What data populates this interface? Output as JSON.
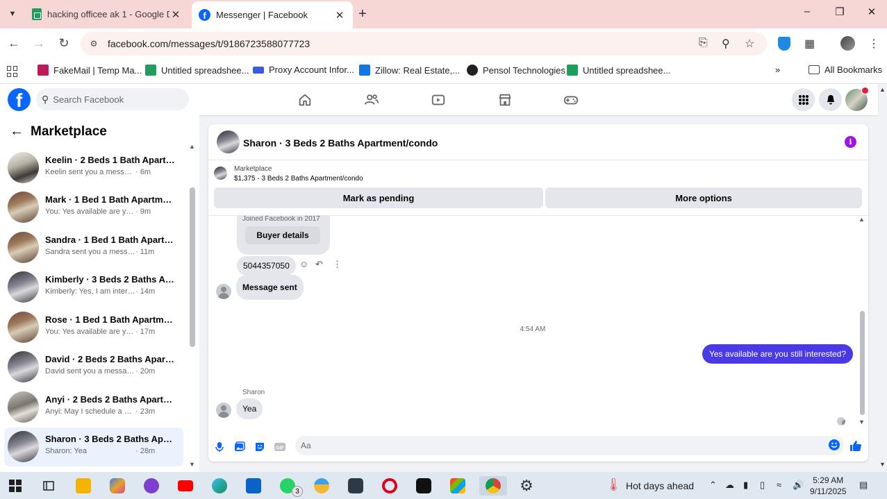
{
  "browser": {
    "tabs": [
      {
        "title": "hacking officee ak 1 - Google D",
        "favicon": "sheets-icon"
      },
      {
        "title": "Messenger | Facebook",
        "favicon": "facebook-icon"
      }
    ],
    "url": "facebook.com/messages/t/9186723588077723",
    "bookmarks": [
      {
        "label": "FakeMail | Temp Ma...",
        "color": "#c2185b"
      },
      {
        "label": "Untitled spreadshee...",
        "color": "#1e9e5a"
      },
      {
        "label": "Proxy Account Infor...",
        "color": "#3b5bdb"
      },
      {
        "label": "Zillow: Real Estate,...",
        "color": "#1277e1"
      },
      {
        "label": "Pensol Technologies",
        "color": "#222222"
      },
      {
        "label": "Untitled spreadshee...",
        "color": "#1e9e5a"
      }
    ],
    "all_bookmarks": "All Bookmarks"
  },
  "facebook": {
    "search_placeholder": "Search Facebook"
  },
  "sidebar": {
    "title": "Marketplace",
    "conversations": [
      {
        "name": "Keelin · 2 Beds 1 Bath Apartmen...",
        "snippet": "Keelin sent you a message about ...",
        "time": "· 6m"
      },
      {
        "name": "Mark · 1 Bed 1 Bath Apartment/...",
        "snippet": "You: Yes available are you still inte...",
        "time": "· 9m"
      },
      {
        "name": "Sandra · 1 Bed 1 Bath Apartmen...",
        "snippet": "Sandra sent you a message abou...",
        "time": "· 11m"
      },
      {
        "name": "Kimberly · 3 Beds 2 Baths Apart...",
        "snippet": "Kimberly: Yes, I am interested. M...",
        "time": "· 14m"
      },
      {
        "name": "Rose · 1 Bed 1 Bath Apartment/c...",
        "snippet": "You: Yes available are you still int...",
        "time": "· 17m"
      },
      {
        "name": "David · 2 Beds 2 Baths Apartme...",
        "snippet": "David sent you a message about...",
        "time": "· 20m"
      },
      {
        "name": "Anyi · 2 Beds 2 Baths Apartmen...",
        "snippet": "Anyi: May I schedule a viewing f...",
        "time": "· 23m"
      },
      {
        "name": "Sharon · 3 Beds 2 Baths Apartm...",
        "snippet": "Sharon: Yea",
        "time": "· 28m"
      }
    ]
  },
  "chat": {
    "title": "Sharon · 3 Beds 2 Baths Apartment/condo",
    "listing_label": "Marketplace",
    "listing_price": "$1,375 - 3 Beds 2 Baths Apartment/condo",
    "mark_pending": "Mark as pending",
    "more_options": "More options",
    "joined": "Joined Facebook in 2017",
    "buyer_details": "Buyer details",
    "phone_msg": "5044357050",
    "sent_msg": "Message sent",
    "timestamp": "4:54 AM",
    "outgoing": "Yes available are you still  interested?",
    "sender": "Sharon",
    "incoming": "Yea",
    "composer_placeholder": "Aa"
  },
  "taskbar": {
    "weather": "Hot days ahead",
    "time": "5:29 AM",
    "date": "9/11/2025",
    "whatsapp_badge": "3"
  }
}
